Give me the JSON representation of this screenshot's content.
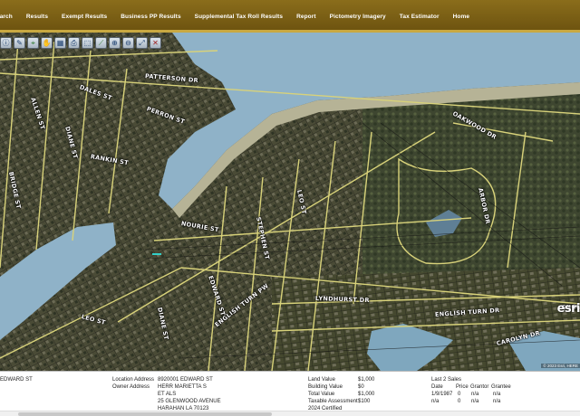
{
  "nav": {
    "items": [
      "Search",
      "Results",
      "Exempt Results",
      "Business PP Results",
      "Supplemental Tax Roll Results",
      "Report",
      "Pictometry Imagery",
      "Tax Estimator",
      "Home"
    ],
    "first_visible": "earch"
  },
  "toolbar": {
    "tools": [
      "identify-icon",
      "pencil-icon",
      "measure-icon",
      "hand-icon",
      "layers-icon",
      "print-icon",
      "select-icon",
      "ruler-icon",
      "zoom-in-icon",
      "zoom-out-icon",
      "full-extent-icon",
      "clear-icon"
    ]
  },
  "map": {
    "streets": [
      "PATTERSON DR",
      "DALES ST",
      "PERRON ST",
      "RANKIN ST",
      "NOURIE ST",
      "ENGLISH TURN PW",
      "OAKWOOD DR",
      "LYNDHURST DR",
      "ENGLISH TURN DR",
      "EDWARD ST",
      "ARBOR DR",
      "ALLEN ST",
      "DIANE ST",
      "BRIDGE ST",
      "LEO ST",
      "STEPHEN ST",
      "CAROLYN DR",
      "ENGLISH TURN PW",
      "LEO ST",
      "DIANE ST"
    ],
    "esri": "esri",
    "attribution": "© 2023 Esri, HERE"
  },
  "info": {
    "address_fragment": "EDWARD ST",
    "location_label": "Location Address",
    "location_value": "8920001 EDWARD ST",
    "owner_label": "Owner Address",
    "owner_lines": [
      "HERR MARIETTA S",
      "ET ALS",
      "25 GLENWOOD AVENUE",
      "HARAHAN LA 70123"
    ],
    "values": [
      {
        "label": "Land Value",
        "value": "$1,000"
      },
      {
        "label": "Building Value",
        "value": "$0"
      },
      {
        "label": "Total Value",
        "value": "$1,000"
      },
      {
        "label": "Taxable Assessment",
        "value": "$100"
      },
      {
        "label": "2024 Certified",
        "value": ""
      }
    ],
    "sales_title": "Last 2 Sales",
    "sales_headers": [
      "Date",
      "Price",
      "Grantor",
      "Grantee"
    ],
    "sales_rows": [
      [
        "1/9/1987",
        "0",
        "n/a",
        "n/a"
      ],
      [
        "n/a",
        "0",
        "n/a",
        "n/a"
      ]
    ]
  },
  "colors": {
    "nav_bg": "#7a5f16",
    "nav_border": "#c9a941",
    "water": "#8fb2c8",
    "road": "#d8d27a",
    "parcel_line": "#1a1a1a"
  }
}
